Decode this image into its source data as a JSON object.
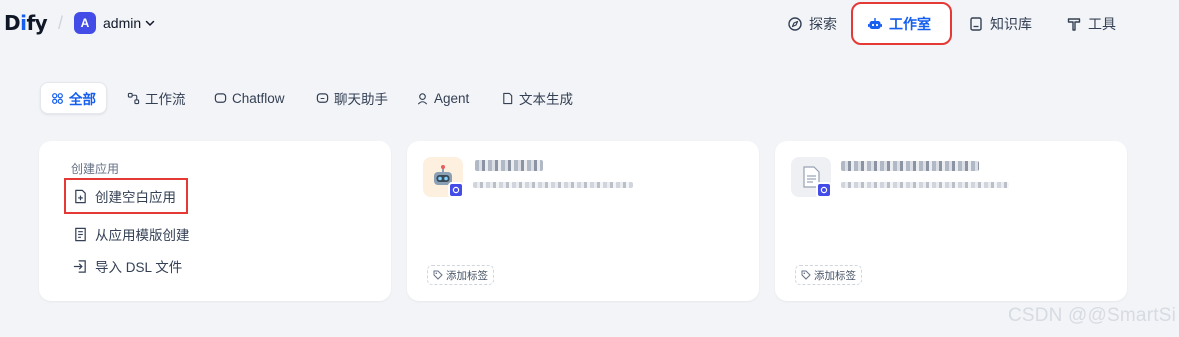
{
  "header": {
    "logo": {
      "part1": "D",
      "part2": "i",
      "part3": "fy"
    },
    "workspace": {
      "avatar_letter": "A",
      "name": "admin"
    },
    "nav": [
      {
        "label": "探索",
        "icon": "compass-icon"
      },
      {
        "label": "工作室",
        "icon": "robot-icon"
      },
      {
        "label": "知识库",
        "icon": "book-icon"
      },
      {
        "label": "工具",
        "icon": "hammer-icon"
      }
    ],
    "active_nav": "工作室"
  },
  "filters": {
    "tabs": [
      {
        "label": "全部",
        "icon": "grid-icon"
      },
      {
        "label": "工作流",
        "icon": "workflow-icon"
      },
      {
        "label": "Chatflow",
        "icon": "chat-bubble-icon"
      },
      {
        "label": "聊天助手",
        "icon": "chat-bot-icon"
      },
      {
        "label": "Agent",
        "icon": "agent-icon"
      },
      {
        "label": "文本生成",
        "icon": "document-icon"
      }
    ],
    "active": "全部"
  },
  "create_card": {
    "title": "创建应用",
    "items": [
      {
        "label": "创建空白应用",
        "icon": "new-file-icon"
      },
      {
        "label": "从应用模版创建",
        "icon": "template-icon"
      },
      {
        "label": "导入 DSL 文件",
        "icon": "import-icon"
      }
    ]
  },
  "apps": [
    {
      "icon": "robot-avatar-icon",
      "add_tag_label": "添加标签"
    },
    {
      "icon": "document-avatar-icon",
      "add_tag_label": "添加标签"
    }
  ],
  "watermark": "CSDN @@SmartSi",
  "colors": {
    "accent": "#155eef",
    "highlight_outline": "#e53935",
    "background": "#f2f4f7"
  }
}
